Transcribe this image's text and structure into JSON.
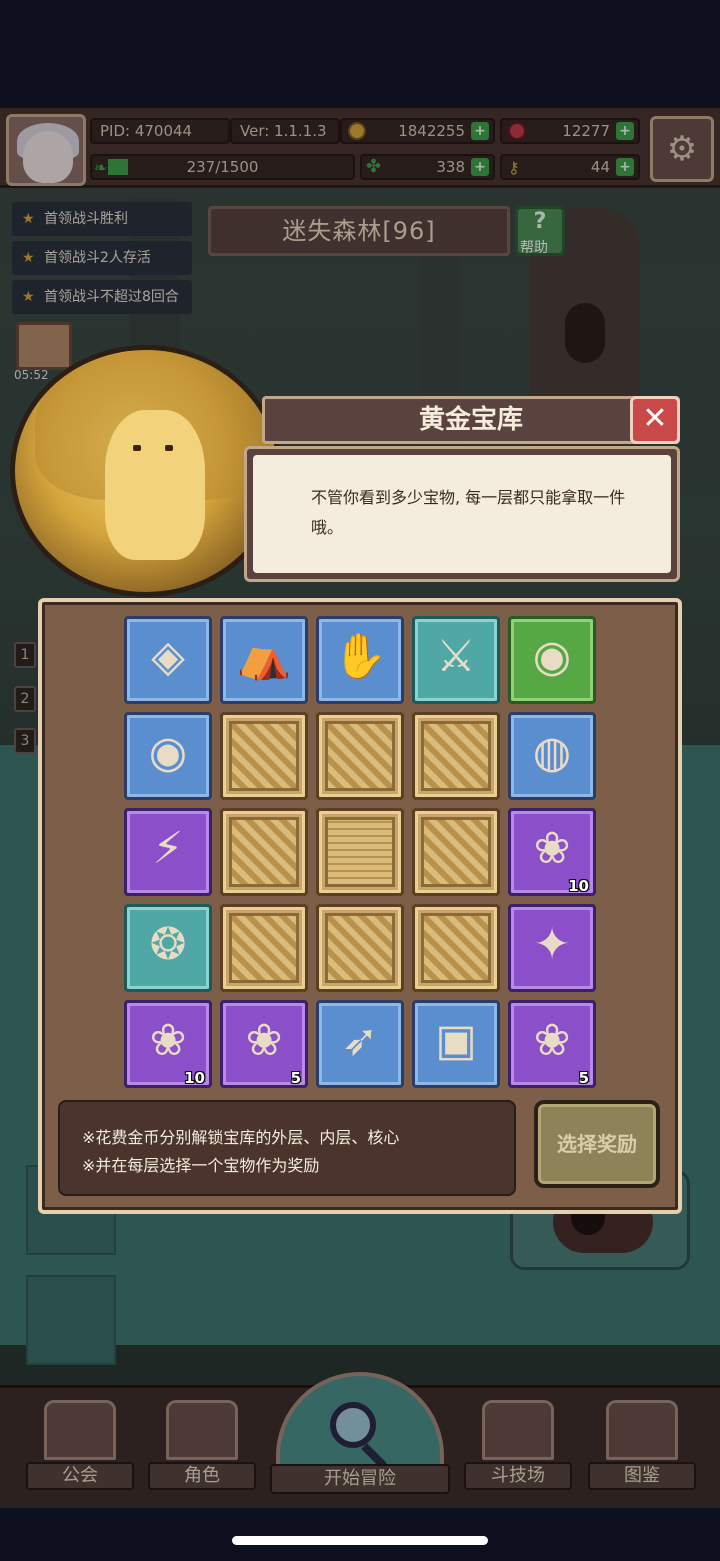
{
  "player": {
    "pid": "PID: 470044",
    "version": "Ver: 1.1.1.3",
    "gold": "1842255",
    "gems": "12277",
    "energy": "237/1500",
    "clover": "338",
    "keys": "44"
  },
  "quests": [
    "首领战斗胜利",
    "首领战斗2人存活",
    "首领战斗不超过8回合"
  ],
  "stage": {
    "title": "迷失森林[96]",
    "help_label": "帮助"
  },
  "gift": {
    "timer": "05:52"
  },
  "side_numbers": [
    "1",
    "2",
    "3"
  ],
  "dialog": {
    "title": "黄金宝库",
    "speech": "不管你看到多少宝物, 每一层都只能拿取一件哦。",
    "grid": [
      [
        {
          "frame": "blue",
          "icon": "diamond-gem-icon",
          "glyph": "◈"
        },
        {
          "frame": "blue",
          "icon": "sack-icon",
          "glyph": "⛺"
        },
        {
          "frame": "blue",
          "icon": "hand-charm-icon",
          "glyph": "✋"
        },
        {
          "frame": "teal",
          "icon": "sword-icon",
          "glyph": "⚔"
        },
        {
          "frame": "green",
          "icon": "orb-amulet-icon",
          "glyph": "◉"
        }
      ],
      [
        {
          "frame": "blue",
          "icon": "orb-amulet-icon",
          "glyph": "◉"
        },
        {
          "frame": "gold",
          "icon": "vault-outer-icon",
          "glyph": ""
        },
        {
          "frame": "gold",
          "icon": "vault-outer-icon",
          "glyph": ""
        },
        {
          "frame": "gold",
          "icon": "vault-outer-icon",
          "glyph": ""
        },
        {
          "frame": "blue",
          "icon": "gold-coin-icon",
          "glyph": "◍"
        }
      ],
      [
        {
          "frame": "purple",
          "icon": "claw-icon",
          "glyph": "⚡"
        },
        {
          "frame": "gold",
          "icon": "vault-outer-icon",
          "glyph": ""
        },
        {
          "frame": "gold",
          "icon": "vault-core-icon",
          "glyph": ""
        },
        {
          "frame": "gold",
          "icon": "vault-outer-icon",
          "glyph": ""
        },
        {
          "frame": "purple",
          "icon": "berry-icon",
          "glyph": "❀",
          "qty": "10"
        }
      ],
      [
        {
          "frame": "teal",
          "icon": "crystal-ring-icon",
          "glyph": "❂"
        },
        {
          "frame": "gold",
          "icon": "vault-outer-icon",
          "glyph": ""
        },
        {
          "frame": "gold",
          "icon": "vault-outer-icon",
          "glyph": ""
        },
        {
          "frame": "gold",
          "icon": "vault-outer-icon",
          "glyph": ""
        },
        {
          "frame": "purple",
          "icon": "crystal-shard-icon",
          "glyph": "✦"
        }
      ],
      [
        {
          "frame": "purple",
          "icon": "berry-icon",
          "glyph": "❀",
          "qty": "10"
        },
        {
          "frame": "purple",
          "icon": "berry-icon",
          "glyph": "❀",
          "qty": "5"
        },
        {
          "frame": "blue",
          "icon": "bow-icon",
          "glyph": "➶"
        },
        {
          "frame": "blue",
          "icon": "rune-tablet-icon",
          "glyph": "▣"
        },
        {
          "frame": "purple",
          "icon": "berry-icon",
          "glyph": "❀",
          "qty": "5"
        }
      ]
    ],
    "notes": [
      "※花费金币分别解锁宝库的外层、内层、核心",
      "※并在每层选择一个宝物作为奖励"
    ],
    "choose_button": "选择奖励",
    "close_icon": "close-icon"
  },
  "nav": [
    "公会",
    "角色",
    "开始冒险",
    "斗技场",
    "图鉴"
  ],
  "colors": {
    "frame_blue": "#5a8ecf",
    "frame_green": "#56a845",
    "frame_teal": "#4fa7a6",
    "frame_purple": "#8a4fc9",
    "frame_gold": "#c9a468",
    "close_red": "#c94848",
    "accent_green": "#3fa14c"
  }
}
